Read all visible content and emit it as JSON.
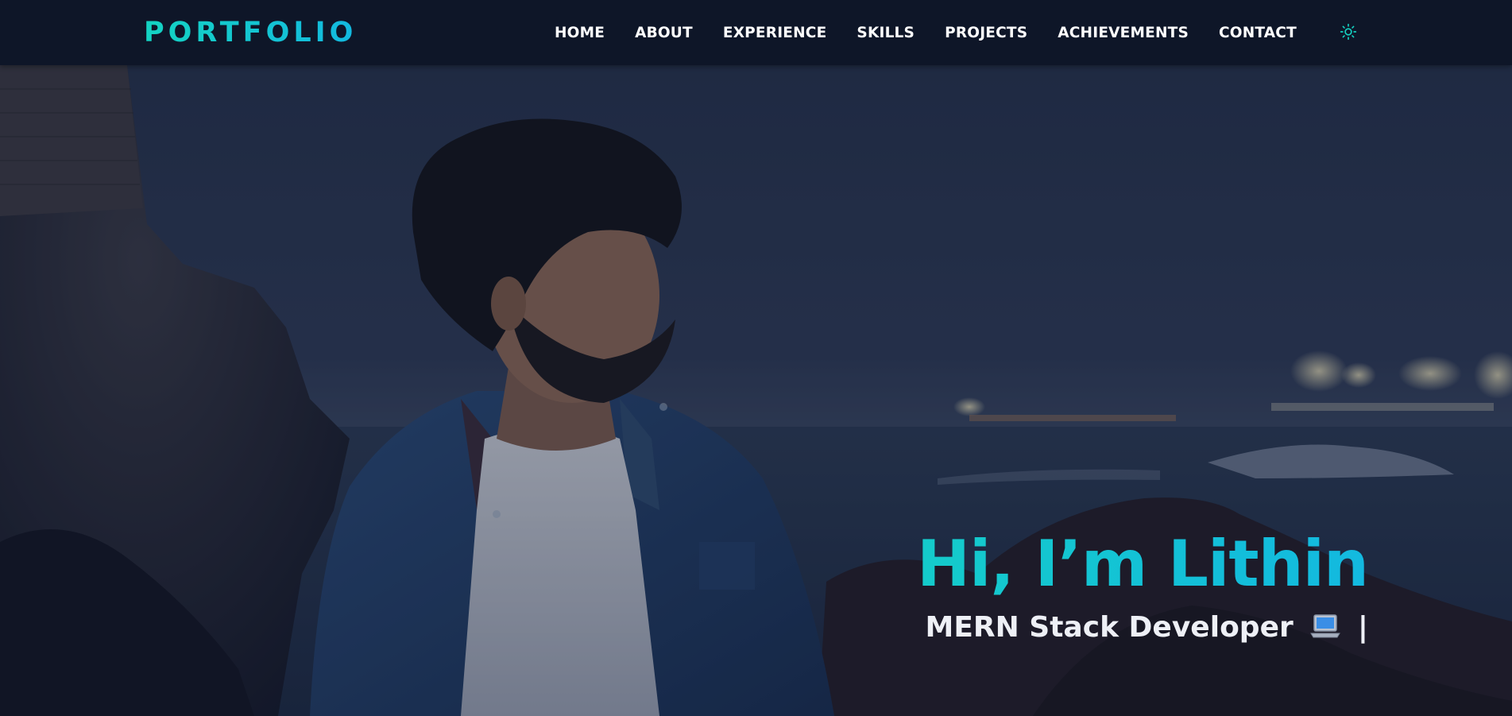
{
  "header": {
    "logo": "PORTFOLIO",
    "nav": [
      {
        "label": "HOME"
      },
      {
        "label": "ABOUT"
      },
      {
        "label": "EXPERIENCE"
      },
      {
        "label": "SKILLS"
      },
      {
        "label": "PROJECTS"
      },
      {
        "label": "ACHIEVEMENTS"
      },
      {
        "label": "CONTACT"
      }
    ],
    "theme_toggle_icon": "sun-icon"
  },
  "hero": {
    "title": "Hi, I’m Lithin",
    "subtitle": "MERN Stack Developer",
    "subtitle_icon": "laptop-icon",
    "cursor": "|"
  },
  "colors": {
    "accent_start": "#14d3c2",
    "accent_end": "#13b9e0",
    "nav_bg": "#0e1628",
    "nav_text": "#ffffff"
  }
}
